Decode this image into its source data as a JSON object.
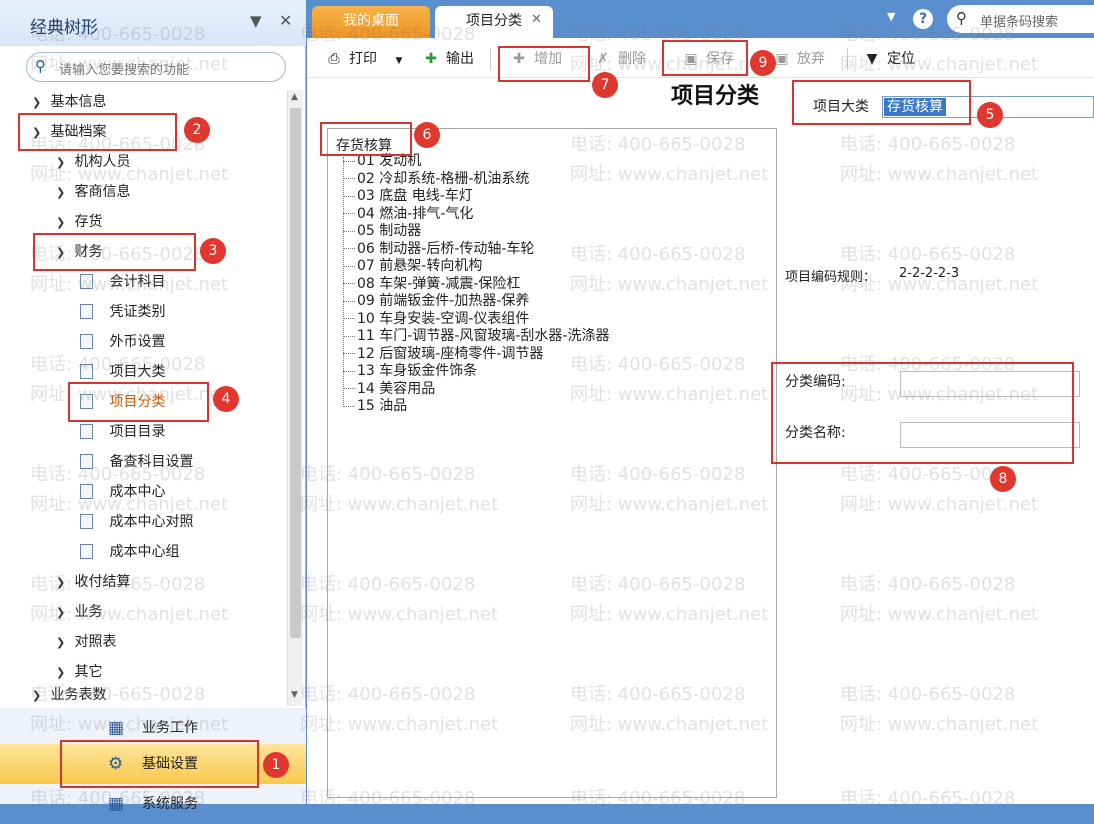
{
  "sidebar": {
    "title": "经典树形",
    "search_placeholder": "请输入您要搜索的功能",
    "tree": [
      {
        "label": "基本信息"
      },
      {
        "label": "基础档案"
      },
      {
        "label": "机构人员"
      },
      {
        "label": "客商信息"
      },
      {
        "label": "存货"
      },
      {
        "label": "财务"
      },
      {
        "label": "会计科目"
      },
      {
        "label": "凭证类别"
      },
      {
        "label": "外币设置"
      },
      {
        "label": "项目大类"
      },
      {
        "label": "项目分类"
      },
      {
        "label": "项目目录"
      },
      {
        "label": "备查科目设置"
      },
      {
        "label": "成本中心"
      },
      {
        "label": "成本中心对照"
      },
      {
        "label": "成本中心组"
      },
      {
        "label": "收付结算"
      },
      {
        "label": "业务"
      },
      {
        "label": "对照表"
      },
      {
        "label": "其它"
      },
      {
        "label": "业务表数"
      }
    ],
    "bottom_nav": [
      {
        "label": "业务工作"
      },
      {
        "label": "基础设置"
      },
      {
        "label": "系统服务"
      }
    ]
  },
  "tabs": [
    {
      "label": "我的桌面"
    },
    {
      "label": "项目分类"
    }
  ],
  "header": {
    "search_placeholder": "单据条码搜索"
  },
  "toolbar": {
    "print": "打印",
    "output": "输出",
    "add": "增加",
    "delete": "删除",
    "save": "保存",
    "discard": "放弃",
    "locate": "定位"
  },
  "main": {
    "title": "项目分类",
    "category_label": "项目大类",
    "category_value": "存货核算",
    "tree_root": "存货核算",
    "tree_items": [
      "01 发动机",
      "02 冷却系统-格栅-机油系统",
      "03 底盘 电线-车灯",
      "04 燃油-排气-气化",
      "05 制动器",
      "06 制动器-后桥-传动轴-车轮",
      "07 前悬架-转向机构",
      "08 车架-弹簧-减震-保险杠",
      "09 前端钣金件-加热器-保养",
      "10 车身安装-空调-仪表组件",
      "11 车门-调节器-风窗玻璃-刮水器-洗涤器",
      "12 后窗玻璃-座椅零件-调节器",
      "13 车身钣金件饰条",
      "14 美容用品",
      "15 油品"
    ],
    "rule_label": "项目编码规则：",
    "rule_value": "2-2-2-2-3",
    "code_label": "分类编码:",
    "name_label": "分类名称:",
    "code_value": "",
    "name_value": ""
  },
  "watermark": {
    "phone": "电话: 400-665-0028",
    "site": "网址: www.chanjet.net"
  },
  "annotations": [
    "1",
    "2",
    "3",
    "4",
    "5",
    "6",
    "7",
    "8",
    "9"
  ],
  "colors": {
    "accent_blue": "#5a8fcf",
    "tab_orange": "#ee9422",
    "annotation_red": "#d9342b",
    "selected_text": "#d05a00"
  }
}
